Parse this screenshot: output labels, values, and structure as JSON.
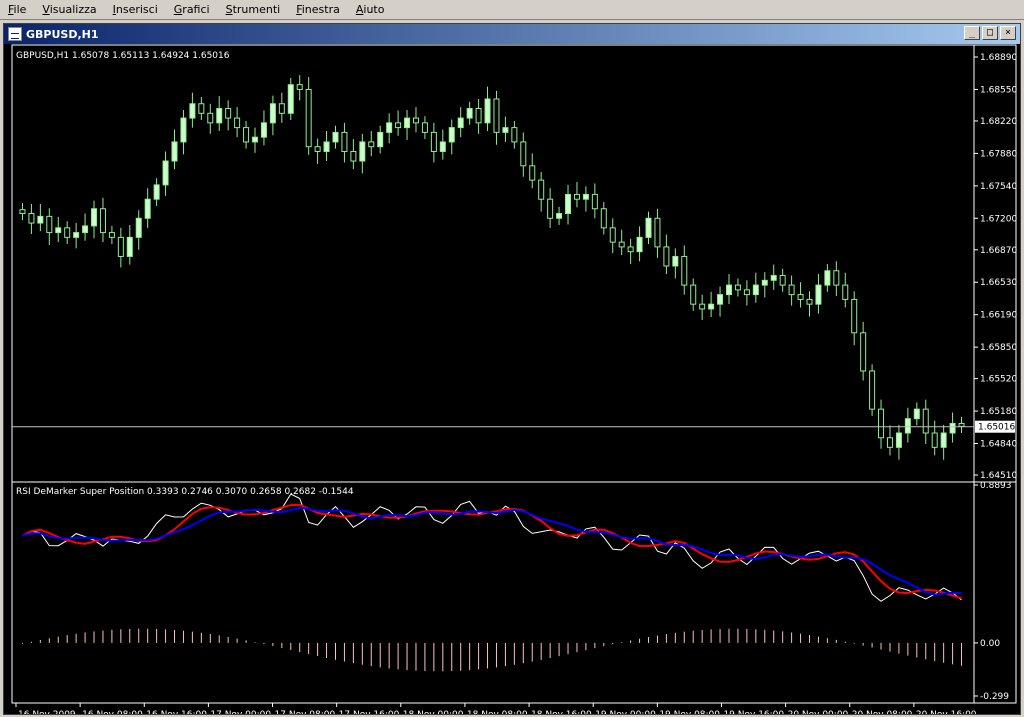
{
  "menubar": {
    "items": [
      "File",
      "Visualizza",
      "Inserisci",
      "Grafici",
      "Strumenti",
      "Finestra",
      "Aiuto"
    ]
  },
  "window": {
    "title": "GBPUSD,H1",
    "buttons": {
      "minimize": "_",
      "maximize": "□",
      "close": "×"
    }
  },
  "colors": {
    "background": "#000000",
    "bull_candle": "#ccffcc",
    "bear_candle": "#000000",
    "wick": "#90ee90",
    "rsi_line_white": "#ffffff",
    "rsi_line_red": "#ff0000",
    "rsi_line_blue": "#0000ff",
    "histogram": "#ffc0c0"
  },
  "chart_data": [
    {
      "type": "candlestick",
      "title": "GBPUSD,H1  1.65078 1.65113 1.64924 1.65016",
      "y_ticks": [
        "1.68890",
        "1.68550",
        "1.68220",
        "1.67880",
        "1.67540",
        "1.67200",
        "1.66870",
        "1.66530",
        "1.66190",
        "1.65850",
        "1.65520",
        "1.65180",
        "1.64840",
        "1.64510"
      ],
      "ylim": [
        1.6451,
        1.6889
      ],
      "current_price": "1.65016",
      "x_ticks": [
        "16 Nov 2009",
        "16 Nov 08:00",
        "16 Nov 16:00",
        "17 Nov 00:00",
        "17 Nov 08:00",
        "17 Nov 16:00",
        "18 Nov 00:00",
        "18 Nov 08:00",
        "18 Nov 16:00",
        "19 Nov 00:00",
        "19 Nov 08:00",
        "19 Nov 16:00",
        "20 Nov 00:00",
        "20 Nov 08:00",
        "20 Nov 16:00"
      ],
      "closes": [
        1.6725,
        1.6715,
        1.6722,
        1.6705,
        1.671,
        1.67,
        1.6705,
        1.6712,
        1.673,
        1.6705,
        1.67,
        1.668,
        1.67,
        1.672,
        1.674,
        1.6755,
        1.678,
        1.68,
        1.6825,
        1.684,
        1.683,
        1.682,
        1.6835,
        1.6825,
        1.6815,
        1.68,
        1.6805,
        1.682,
        1.684,
        1.683,
        1.686,
        1.6855,
        1.6795,
        1.679,
        1.68,
        1.681,
        1.679,
        1.678,
        1.68,
        1.6795,
        1.681,
        1.682,
        1.6815,
        1.6825,
        1.682,
        1.681,
        1.679,
        1.68,
        1.6815,
        1.6825,
        1.6835,
        1.682,
        1.6845,
        1.681,
        1.6815,
        1.68,
        1.6775,
        1.676,
        1.674,
        1.672,
        1.6725,
        1.6745,
        1.674,
        1.6745,
        1.673,
        1.671,
        1.6695,
        1.669,
        1.6685,
        1.67,
        1.672,
        1.669,
        1.667,
        1.668,
        1.665,
        1.663,
        1.6625,
        1.663,
        1.664,
        1.665,
        1.6645,
        1.664,
        1.665,
        1.6655,
        1.666,
        1.665,
        1.664,
        1.6635,
        1.663,
        1.665,
        1.6665,
        1.665,
        1.6635,
        1.66,
        1.656,
        1.652,
        1.649,
        1.648,
        1.6495,
        1.651,
        1.652,
        1.6495,
        1.648,
        1.6495,
        1.6505,
        1.6502
      ]
    },
    {
      "type": "line",
      "title": "RSI DeMarker Super Position 0.3393 0.2746 0.3070 0.2658 0.2682 -0.1544",
      "y_ticks": [
        "0.8893",
        "0.00",
        "-0.299"
      ],
      "ylim": [
        -0.299,
        0.8893
      ]
    }
  ]
}
